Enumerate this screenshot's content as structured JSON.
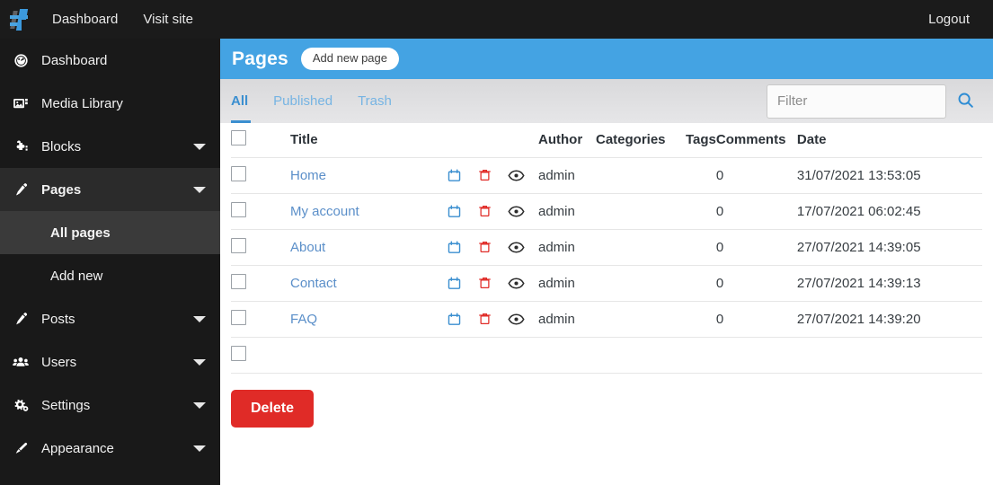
{
  "topbar": {
    "logo_icon": "site-logo-icon",
    "links": [
      {
        "label": "Dashboard",
        "name": "topnav-dashboard"
      },
      {
        "label": "Visit site",
        "name": "topnav-visit-site"
      }
    ],
    "logout_label": "Logout"
  },
  "sidebar": {
    "items": [
      {
        "label": "Dashboard",
        "icon": "gauge-icon",
        "caret": false,
        "active": false
      },
      {
        "label": "Media Library",
        "icon": "image-icon",
        "caret": false,
        "active": false
      },
      {
        "label": "Blocks",
        "icon": "puzzle-icon",
        "caret": true,
        "active": false
      },
      {
        "label": "Pages",
        "icon": "pen-icon",
        "caret": true,
        "active": true
      },
      {
        "label": "Posts",
        "icon": "pen-icon",
        "caret": true,
        "active": false
      },
      {
        "label": "Users",
        "icon": "users-icon",
        "caret": true,
        "active": false
      },
      {
        "label": "Settings",
        "icon": "gears-icon",
        "caret": true,
        "active": false
      },
      {
        "label": "Appearance",
        "icon": "paintbrush-icon",
        "caret": true,
        "active": false
      }
    ],
    "pages_submenu": [
      {
        "label": "All pages",
        "current": true
      },
      {
        "label": "Add new",
        "current": false
      }
    ]
  },
  "header": {
    "title": "Pages",
    "add_new_label": "Add new page",
    "background_color": "#44a3e3"
  },
  "tabs": [
    {
      "label": "All",
      "active": true
    },
    {
      "label": "Published",
      "active": false
    },
    {
      "label": "Trash",
      "active": false
    }
  ],
  "filter": {
    "value": "",
    "placeholder": "Filter",
    "search_icon": "search-icon",
    "accent_color": "#3b8fd0"
  },
  "table": {
    "columns": [
      "Title",
      "Author",
      "Categories",
      "Tags",
      "Comments",
      "Date"
    ],
    "row_actions": [
      {
        "name": "duplicate-icon",
        "color": "#3b8fd0"
      },
      {
        "name": "trash-icon",
        "color": "#e02b27"
      },
      {
        "name": "eye-icon",
        "color": "#2b2b2b"
      }
    ],
    "rows": [
      {
        "title": "Home",
        "author": "admin",
        "categories": "",
        "tags": "",
        "comments": "0",
        "date": "31/07/2021 13:53:05"
      },
      {
        "title": "My account",
        "author": "admin",
        "categories": "",
        "tags": "",
        "comments": "0",
        "date": "17/07/2021 06:02:45"
      },
      {
        "title": "About",
        "author": "admin",
        "categories": "",
        "tags": "",
        "comments": "0",
        "date": "27/07/2021 14:39:05"
      },
      {
        "title": "Contact",
        "author": "admin",
        "categories": "",
        "tags": "",
        "comments": "0",
        "date": "27/07/2021 14:39:13"
      },
      {
        "title": "FAQ",
        "author": "admin",
        "categories": "",
        "tags": "",
        "comments": "0",
        "date": "27/07/2021 14:39:20"
      }
    ]
  },
  "footer": {
    "delete_label": "Delete",
    "delete_color": "#e02b27"
  }
}
